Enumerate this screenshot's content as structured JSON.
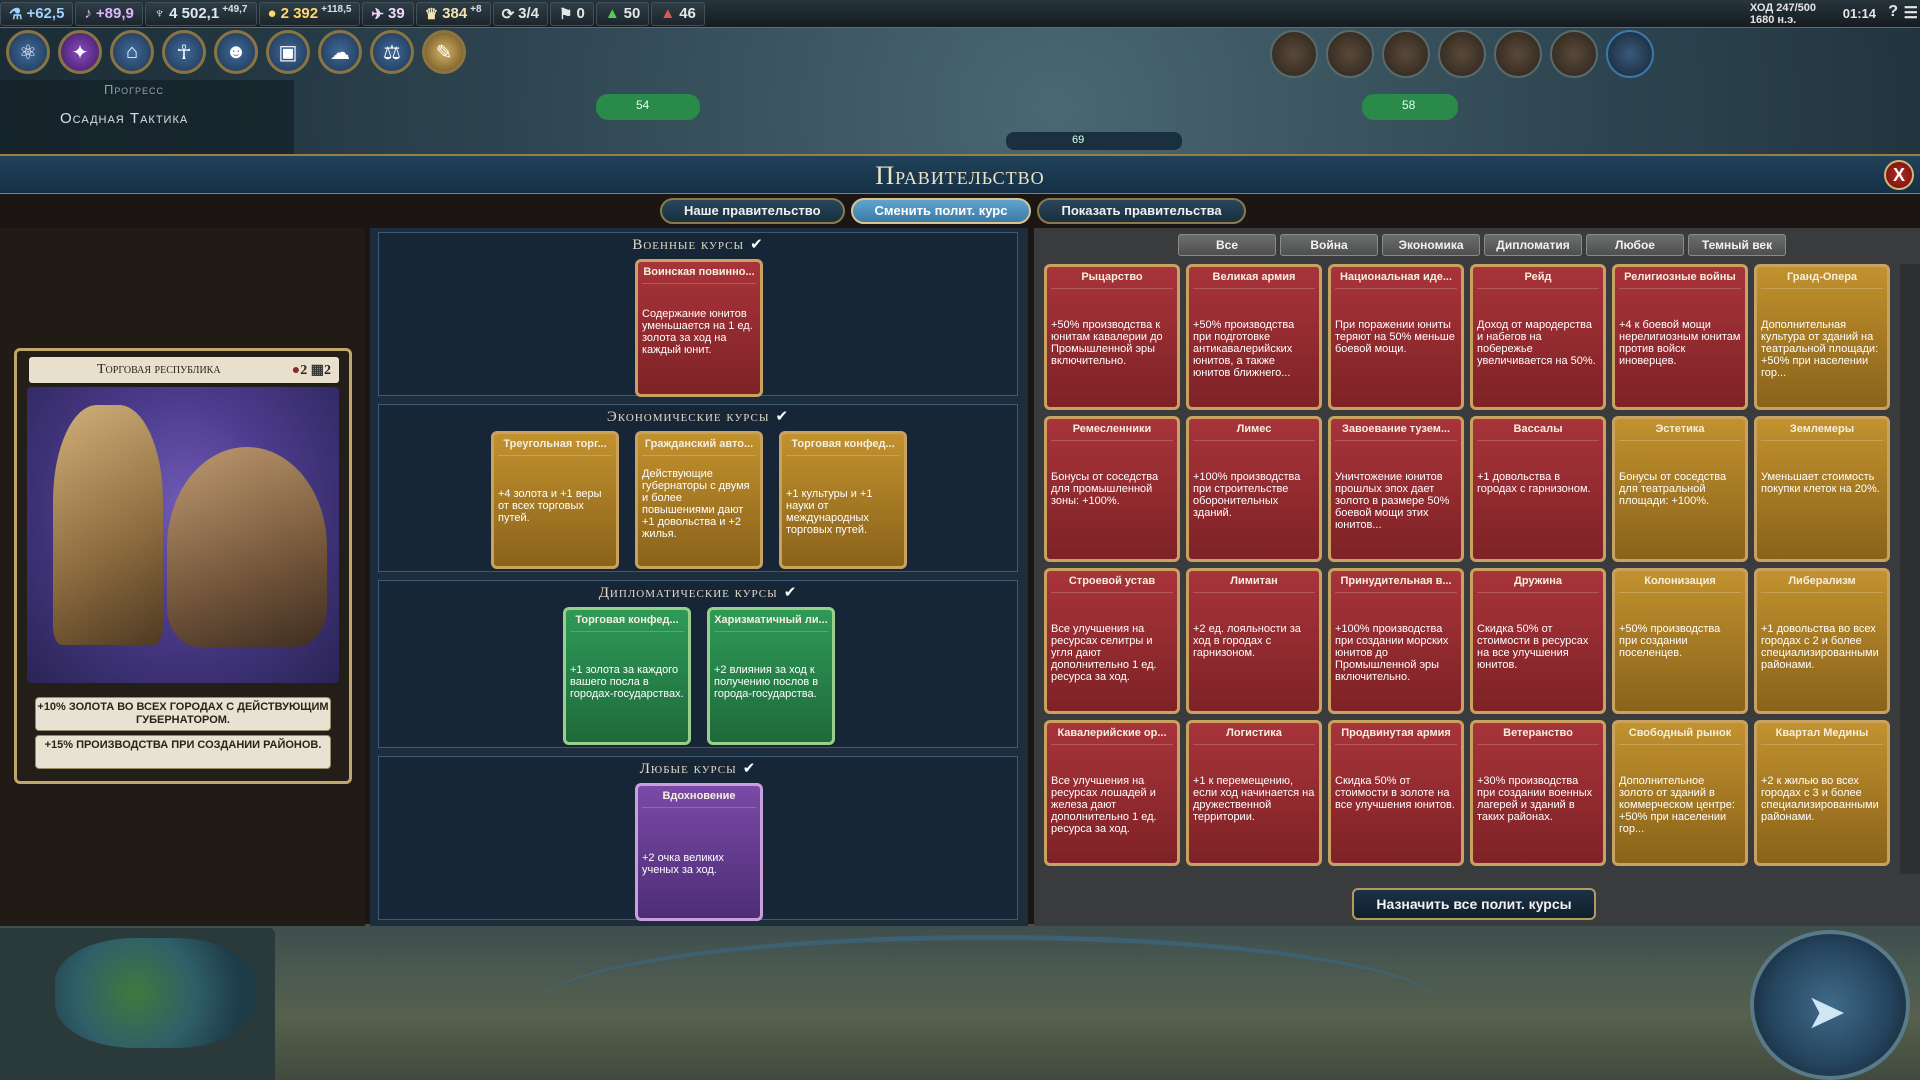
{
  "top_bar": {
    "science": "+62,5",
    "culture": "+89,9",
    "faith_total": "4 502,1",
    "faith_delta": "+49,7",
    "gold_total": "2 392",
    "gold_delta": "+118,5",
    "tourism": "39",
    "favor_total": "384",
    "favor_delta": "+8",
    "trade_routes": "3/4",
    "units": "0",
    "flow1": "50",
    "flow2": "46",
    "turn": "ХОД 247/500",
    "year": "1680 н.э.",
    "clock": "01:14",
    "help": "?",
    "menu": "☰"
  },
  "progress_panel": {
    "title": "Прогресс",
    "item": "Осадная Тактика"
  },
  "gov": {
    "title": "Правительство",
    "close": "X",
    "tabs": [
      "Наше правительство",
      "Сменить полит. курс",
      "Показать правительства"
    ],
    "civ_name": "Торговая республика",
    "slot_a": "2",
    "slot_b": "2",
    "bonus1": "+10% золота во всех городах с действующим губернатором.",
    "bonus2": "+15% производства при создании районов.",
    "groups": {
      "military": "Военные курсы",
      "economic": "Экономические курсы",
      "diplomatic": "Дипломатические курсы",
      "wild": "Любые курсы"
    },
    "slotted": {
      "mil1_name": "Воинская повинно...",
      "mil1_desc": "Содержание юнитов уменьшается на 1 ед. золота за ход на каждый юнит.",
      "eco1_name": "Треугольная торг...",
      "eco1_desc": "+4 золота и +1 веры от всех торговых путей.",
      "eco2_name": "Гражданский авто...",
      "eco2_desc": "Действующие губернаторы с двумя и более повышениями дают +1 довольства и +2 жилья.",
      "eco3_name": "Торговая конфед...",
      "eco3_desc": "+1 культуры и +1 науки от международных торговых путей.",
      "dip1_name": "Торговая конфед...",
      "dip1_desc": "+1 золота за каждого вашего посла в городах-государствах.",
      "dip2_name": "Харизматичный ли...",
      "dip2_desc": "+2 влияния за ход к получению послов в города-государства.",
      "wild1_name": "Вдохновение",
      "wild1_desc": "+2 очка великих ученых за ход."
    },
    "filters": [
      "Все",
      "Война",
      "Экономика",
      "Дипломатия",
      "Любое",
      "Темный век"
    ],
    "policies": [
      {
        "name": "Рыцарство",
        "desc": "+50% производства к юнитам кавалерии до Промышленной эры включительно.",
        "kind": "mil"
      },
      {
        "name": "Великая армия",
        "desc": "+50% производства при подготовке антикавалерийских юнитов, а также юнитов ближнего...",
        "kind": "mil"
      },
      {
        "name": "Национальная иде...",
        "desc": "При поражении юниты теряют на 50% меньше боевой мощи.",
        "kind": "mil"
      },
      {
        "name": "Рейд",
        "desc": "Доход от мародерства и набегов на побережье увеличивается на 50%.",
        "kind": "mil"
      },
      {
        "name": "Религиозные войны",
        "desc": "+4 к боевой мощи нерелигиозным юнитам против войск иноверцев.",
        "kind": "mil"
      },
      {
        "name": "Гранд-Опера",
        "desc": "Дополнительная культура от зданий на театральной площади: +50% при населении гор...",
        "kind": "eco"
      },
      {
        "name": "Ремесленники",
        "desc": "Бонусы от соседства для промышленной зоны: +100%.",
        "kind": "mil"
      },
      {
        "name": "Лимес",
        "desc": "+100% производства при строительстве оборонительных зданий.",
        "kind": "mil"
      },
      {
        "name": "Завоевание тузем...",
        "desc": "Уничтожение юнитов прошлых эпох дает золото в размере 50% боевой мощи этих юнитов...",
        "kind": "mil"
      },
      {
        "name": "Вассалы",
        "desc": "+1 довольства в городах с гарнизоном.",
        "kind": "mil"
      },
      {
        "name": "Эстетика",
        "desc": "Бонусы от соседства для театральной площади: +100%.",
        "kind": "eco"
      },
      {
        "name": "Землемеры",
        "desc": "Уменьшает стоимость покупки клеток на 20%.",
        "kind": "eco"
      },
      {
        "name": "Строевой устав",
        "desc": "Все улучшения на ресурсах селитры и угля дают дополнительно 1 ед. ресурса за ход.",
        "kind": "mil"
      },
      {
        "name": "Лимитан",
        "desc": "+2 ед. лояльности за ход в городах с гарнизоном.",
        "kind": "mil"
      },
      {
        "name": "Принудительная в...",
        "desc": "+100% производства при создании морских юнитов до Промышленной эры включительно.",
        "kind": "mil"
      },
      {
        "name": "Дружина",
        "desc": "Скидка 50% от стоимости в ресурсах на все улучшения юнитов.",
        "kind": "mil"
      },
      {
        "name": "Колонизация",
        "desc": "+50% производства при создании поселенцев.",
        "kind": "eco"
      },
      {
        "name": "Либерализм",
        "desc": "+1 довольства во всех городах с 2 и более специализированными районами.",
        "kind": "eco"
      },
      {
        "name": "Кавалерийские ор...",
        "desc": "Все улучшения на ресурсах лошадей и железа дают дополнительно 1 ед. ресурса за ход.",
        "kind": "mil"
      },
      {
        "name": "Логистика",
        "desc": "+1 к перемещению, если ход начинается на дружественной территории.",
        "kind": "mil"
      },
      {
        "name": "Продвинутая армия",
        "desc": "Скидка 50% от стоимости в золоте на все улучшения юнитов.",
        "kind": "mil"
      },
      {
        "name": "Ветеранство",
        "desc": "+30% производства при создании военных лагерей и зданий в таких районах.",
        "kind": "mil"
      },
      {
        "name": "Свободный рынок",
        "desc": "Дополнительное золото от зданий в коммерческом центре: +50% при населении гор...",
        "kind": "eco"
      },
      {
        "name": "Квартал Медины",
        "desc": "+2 к жилью во всех городах с 3 и более специализированными районами.",
        "kind": "eco"
      }
    ],
    "assign_all": "Назначить все полит. курсы"
  },
  "map_labels": {
    "city1": "54",
    "city2": "58",
    "city3": "69"
  }
}
